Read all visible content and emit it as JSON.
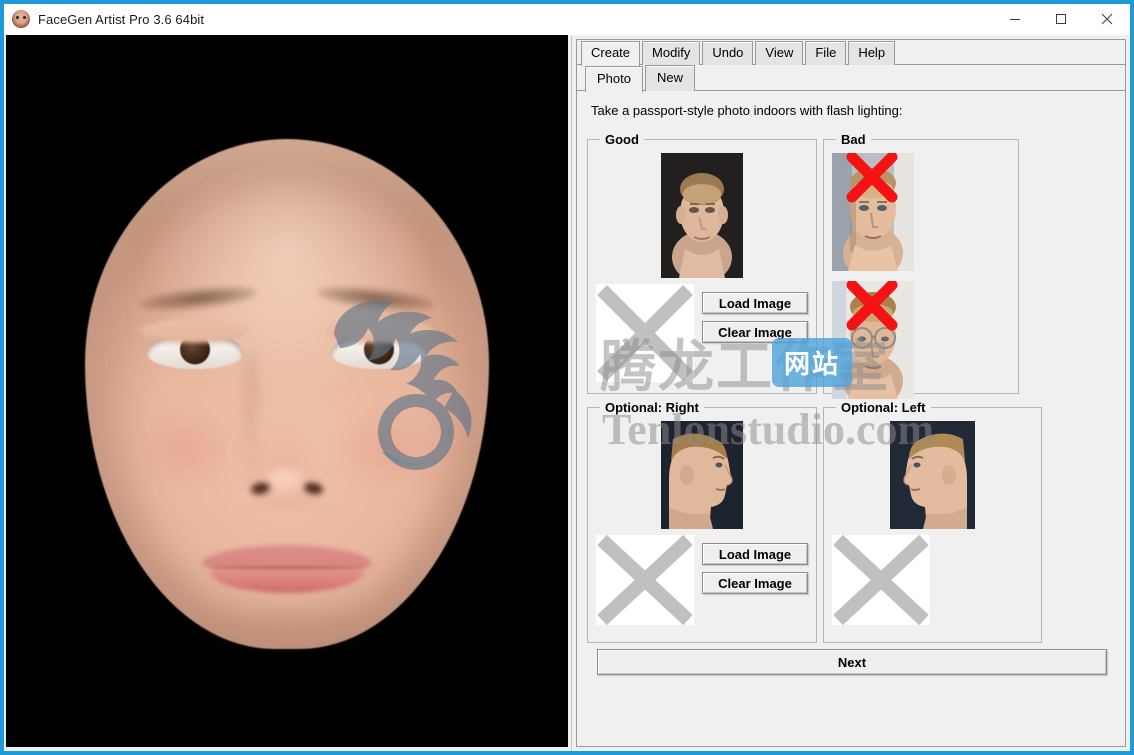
{
  "window": {
    "title": "FaceGen Artist Pro 3.6 64bit",
    "icon": "face-icon",
    "minimize": "–",
    "maximize": "□",
    "close": "✕",
    "accent_color": "#1e9bd7",
    "panel_bg": "#f0f0f0"
  },
  "main_tabs": [
    {
      "label": "Create",
      "active": true
    },
    {
      "label": "Modify",
      "active": false
    },
    {
      "label": "Undo",
      "active": false
    },
    {
      "label": "View",
      "active": false
    },
    {
      "label": "File",
      "active": false
    },
    {
      "label": "Help",
      "active": false
    }
  ],
  "sub_tabs": [
    {
      "label": "Photo",
      "active": true
    },
    {
      "label": "New",
      "active": false
    }
  ],
  "instruction": "Take a passport-style photo indoors with flash lighting:",
  "groups": {
    "good": {
      "legend": "Good",
      "example_caption": "frontal passport photo example",
      "placeholder": "empty-image-placeholder",
      "load_label": "Load Image",
      "clear_label": "Clear Image"
    },
    "bad": {
      "legend": "Bad",
      "examples": [
        {
          "caption": "harsh side lighting example",
          "marked": true
        },
        {
          "caption": "wearing glasses example",
          "marked": true
        }
      ],
      "reject_mark": "red-x-mark"
    },
    "optional_right": {
      "legend": "Optional: Right",
      "example_caption": "right profile example",
      "placeholder": "empty-image-placeholder",
      "load_label": "Load Image",
      "clear_label": "Clear Image"
    },
    "optional_left": {
      "legend": "Optional: Left",
      "example_caption": "left profile example",
      "placeholder": "empty-image-placeholder"
    }
  },
  "next_label": "Next",
  "viewport": {
    "model": "3d-face-model",
    "background": "#000000"
  },
  "watermark": {
    "logo": "dragon-logo",
    "studio_cn": "腾龙工作室",
    "badge_cn": "网站",
    "url": "Tenlonstudio.com"
  }
}
